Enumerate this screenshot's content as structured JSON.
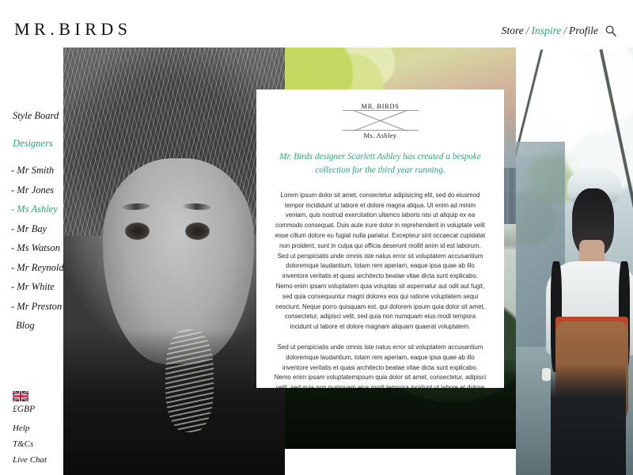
{
  "site": {
    "logo": "MR.BIRDS"
  },
  "nav": {
    "items": [
      {
        "label": "Store",
        "active": false
      },
      {
        "label": "Inspire",
        "active": true
      },
      {
        "label": "Profile",
        "active": false
      }
    ],
    "separator": "/",
    "search_icon": "search-icon"
  },
  "sidebar": {
    "style_board": "Style Board",
    "designers_heading": "Designers",
    "designers": [
      "- Mr Smith",
      "- Mr Jones",
      "- Ms Ashley",
      "- Mr Bay",
      "- Ms Watson",
      "- Mr Reynold",
      "- Mr White",
      "- Mr Preston"
    ],
    "active_designer": "- Ms Ashley",
    "blog": "Blog"
  },
  "footer": {
    "flag_icon": "uk-flag-icon",
    "currency": "£GBP",
    "links": [
      "Help",
      "T&Cs",
      "Live Chat"
    ]
  },
  "card": {
    "mark_top": "MR. BIRDS",
    "mark_bottom": "Ms. Ashley",
    "headline": "Mr. Birds designer Scarlett Ashley  has created a bespoke collection for the third year running.",
    "paragraphs": [
      "Lorem ipsum dolor sit amet, consectetur adipisicing elit, sed do eiusmod tempor incididunt ut labore et dolore magna aliqua. Ut enim ad minim veniam, quis nostrud exercitation ullamco laboris nisi ut aliquip ex ea commodo consequat. Duis aute irure dolor in reprehenderit in voluptate velit esse cillum dolore eu fugiat nulla pariatur. Excepteur sint occaecat cupidatat non proident, sunt in culpa qui officia deserunt mollit anim id est laborum. Sed ut perspiciatis unde omnis iste natus error sit voluptatem accusantium doloremque laudantium, totam rem aperiam, eaque ipsa quae ab illo inventore veritatis et quasi architecto beatae vitae dicta sunt explicabo. Nemo enim ipsam voluptatem quia voluptas sit aspernatur aut odit aut fugit, sed quia consequuntur magni dolores eos qui ratione voluptatem sequi nesciunt. Neque porro quisquam est, qui dolorem ipsum quia dolor sit amet, consectetur, adipisci velit, sed quia non numquam eius modi tempora incidunt ut labore et dolore magnam aliquam quaerat voluptatem.",
      "Sed ut perspiciatis unde omnis iste natus error sit voluptatem accusantium doloremque laudantium, totam rem aperiam, eaque ipsa quae ab illo inventore veritatis et quasi architecto beatae vitae dicta sunt explicabo. Nemo enim ipsam voluptatemipsum quia dolor sit amet, consectetur, adipisci velit, sed quia non numquam eius modi tempora incidunt ut labore et dolore magnam aliquam quaerat voluptatem"
    ]
  },
  "colors": {
    "accent_green": "#2aa574",
    "text_dark": "#151515",
    "page_background": "#ffffff"
  },
  "images": {
    "left": "portrait-black-white-woman",
    "middle": "street-scene-foliage",
    "right": "person-backpack-walking"
  }
}
